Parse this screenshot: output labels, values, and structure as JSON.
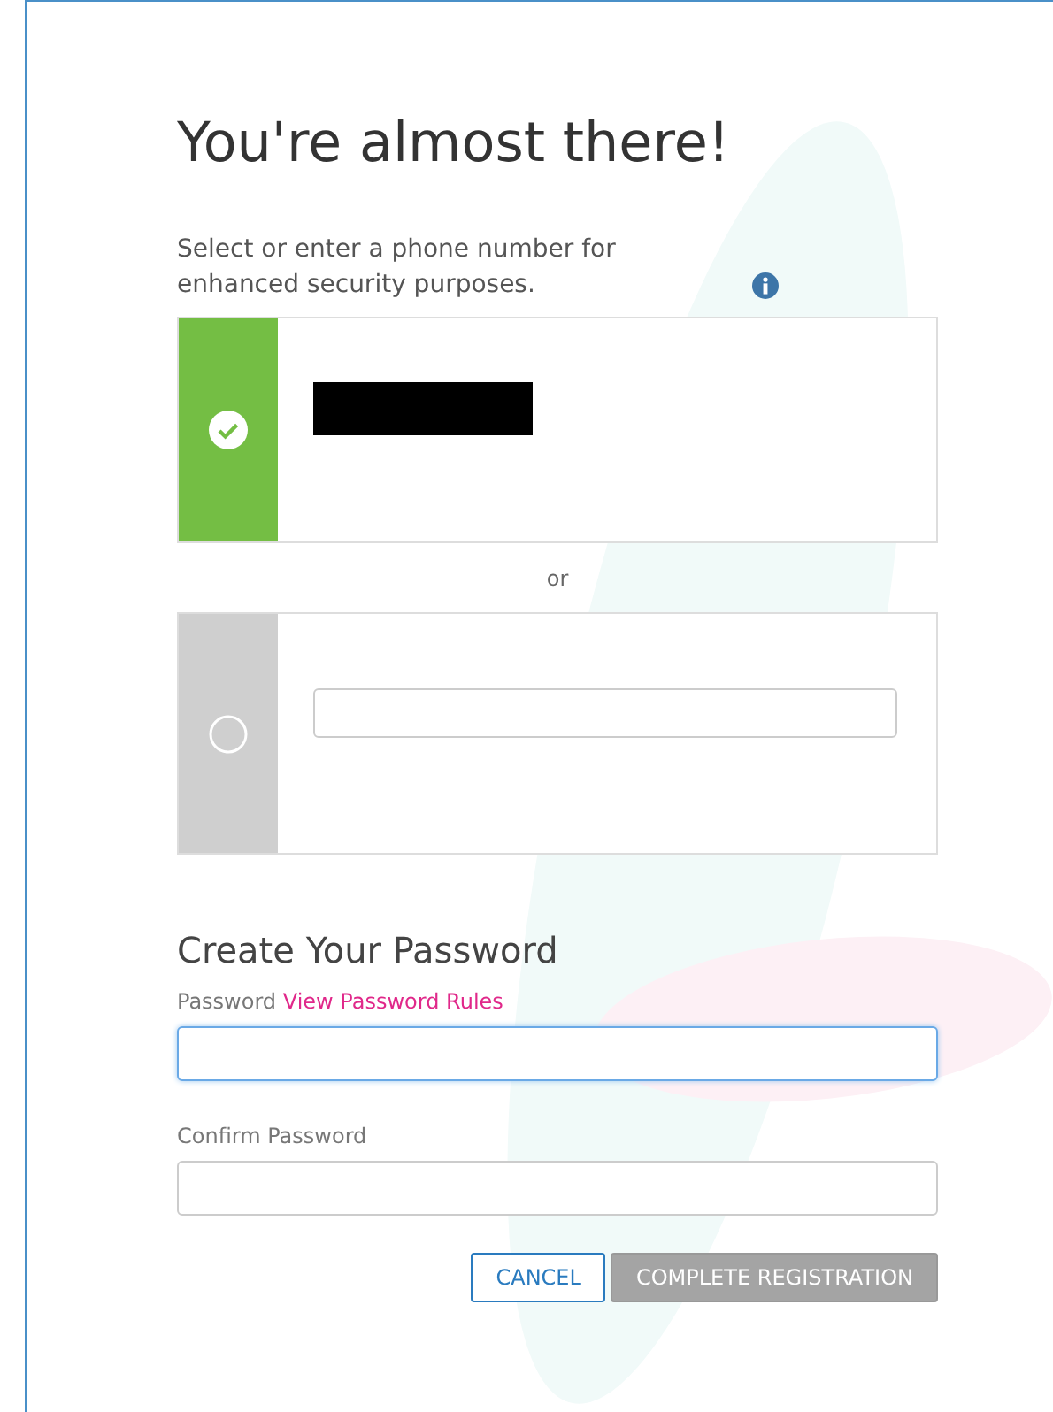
{
  "title": "You're almost there!",
  "description": "Select or enter a phone number for enhanced security purposes.",
  "phone_options": [
    {
      "kind": "existing",
      "selected": true
    },
    {
      "kind": "new",
      "selected": false
    }
  ],
  "separator": "or",
  "password_section": {
    "heading": "Create Your Password",
    "password_label": "Password",
    "rules_link": "View Password Rules",
    "password_focused": true,
    "confirm_label": "Confirm Password"
  },
  "buttons": [
    {
      "label": "CANCEL",
      "disabled": false
    },
    {
      "label": "COMPLETE REGISTRATION",
      "disabled": true
    }
  ]
}
